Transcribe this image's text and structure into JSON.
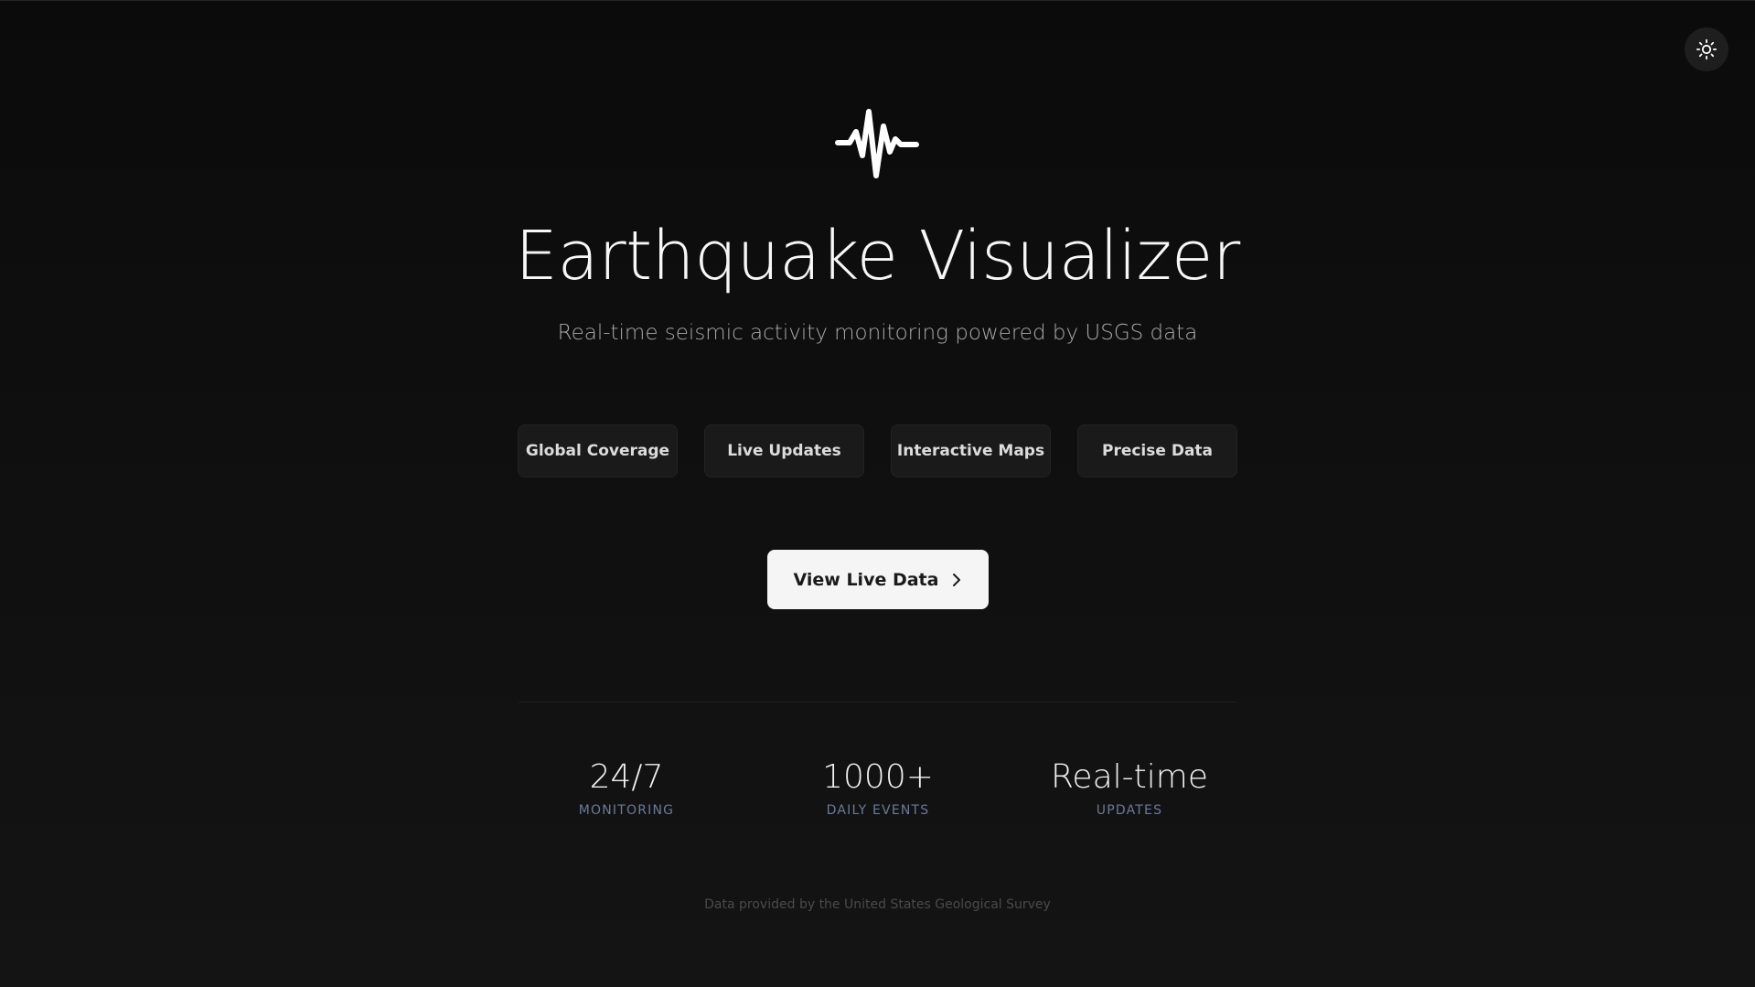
{
  "header": {
    "theme_toggle_icon": "sun-icon"
  },
  "hero": {
    "logo_icon": "seismic-wave-icon",
    "title": "Earthquake Visualizer",
    "subtitle": "Real-time seismic activity monitoring powered by USGS data"
  },
  "features": [
    {
      "label": "Global Coverage"
    },
    {
      "label": "Live Updates"
    },
    {
      "label": "Interactive Maps"
    },
    {
      "label": "Precise Data"
    }
  ],
  "cta": {
    "label": "View Live Data",
    "icon": "chevron-right-icon"
  },
  "stats": [
    {
      "value": "24/7",
      "label": "MONITORING"
    },
    {
      "value": "1000+",
      "label": "DAILY EVENTS"
    },
    {
      "value": "Real-time",
      "label": "UPDATES"
    }
  ],
  "footer": {
    "text": "Data provided by the United States Geological Survey"
  },
  "colors": {
    "background": "#0f0f0f",
    "pill_background": "#1a1a1a",
    "cta_background": "#f5f5f5",
    "stat_label": "#6a7a99"
  }
}
